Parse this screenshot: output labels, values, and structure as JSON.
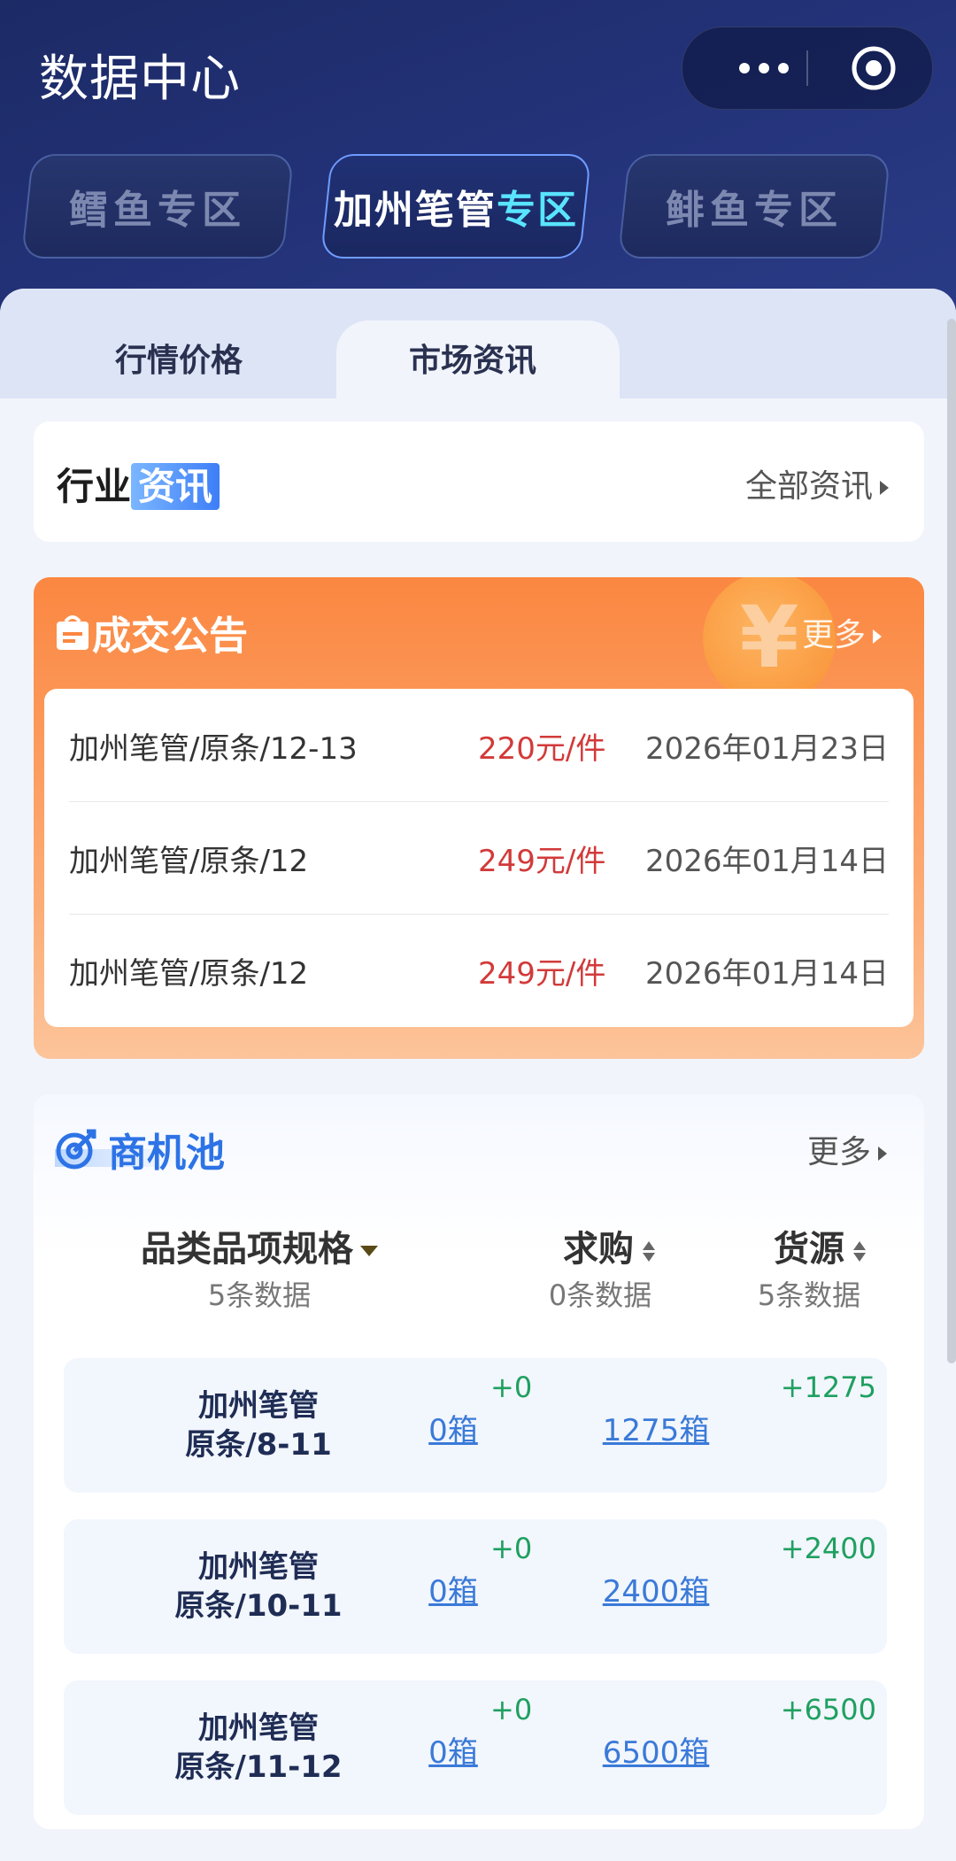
{
  "header": {
    "title": "数据中心"
  },
  "zones": [
    {
      "label": "鳕鱼专区"
    },
    {
      "label_pre": "加州笔管",
      "label_hl": "专区",
      "active": true
    },
    {
      "label": "鲱鱼专区"
    }
  ],
  "sub_tabs": [
    {
      "label": "行情价格"
    },
    {
      "label": "市场资讯",
      "active": true
    }
  ],
  "news": {
    "title_a": "行业",
    "title_b": "资讯",
    "more": "全部资讯"
  },
  "deals": {
    "title": "成交公告",
    "more": "更多",
    "coin_symbol": "¥",
    "rows": [
      {
        "name": "加州笔管/原条/12-13",
        "price": "220元/件",
        "date": "2026年01月23日"
      },
      {
        "name": "加州笔管/原条/12",
        "price": "249元/件",
        "date": "2026年01月14日"
      },
      {
        "name": "加州笔管/原条/12",
        "price": "249元/件",
        "date": "2026年01月14日"
      }
    ]
  },
  "opportunities": {
    "title": "商机池",
    "more": "更多",
    "columns": [
      {
        "label": "品类品项规格",
        "sub": "5条数据"
      },
      {
        "label": "求购",
        "sub": "0条数据"
      },
      {
        "label": "货源",
        "sub": "5条数据"
      }
    ],
    "rows": [
      {
        "line1": "加州笔管",
        "line2": "原条/8-11",
        "demand_delta": "+0",
        "demand": "0箱",
        "supply_delta": "+1275",
        "supply": "1275箱"
      },
      {
        "line1": "加州笔管",
        "line2": "原条/10-11",
        "demand_delta": "+0",
        "demand": "0箱",
        "supply_delta": "+2400",
        "supply": "2400箱"
      },
      {
        "line1": "加州笔管",
        "line2": "原条/11-12",
        "demand_delta": "+0",
        "demand": "0箱",
        "supply_delta": "+6500",
        "supply": "6500箱"
      }
    ]
  },
  "colors": {
    "accent": "#2d73e6",
    "deal_orange": "#fb8741",
    "price_red": "#d23a3a",
    "delta_green": "#1fa060",
    "header_bg": "#1c2a66"
  }
}
